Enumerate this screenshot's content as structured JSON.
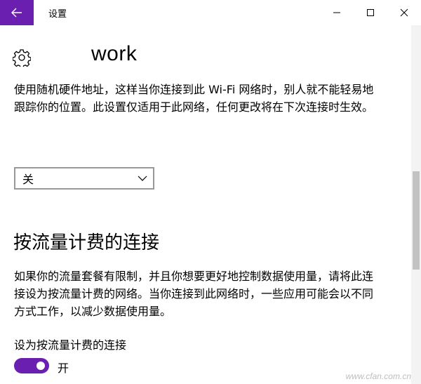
{
  "window": {
    "title": "设置",
    "back_icon": "arrow-left-icon",
    "controls": [
      "minimize-icon",
      "maximize-icon",
      "close-icon"
    ],
    "accent_color": "#6b1fb1"
  },
  "header": {
    "icon": "gear-icon",
    "network_name": "work"
  },
  "random_hw": {
    "description": "使用随机硬件地址，这样当你连接到此 Wi-Fi 网络时，别人就不能轻易地跟踪你的位置。此设置仅适用于此网络，任何更改将在下次连接时生效。",
    "dropdown_value": "关"
  },
  "metered": {
    "title": "按流量计费的连接",
    "description": "如果你的流量套餐有限制，并且你想要更好地控制数据使用量，请将此连接设为按流量计费的网络。当你连接到此网络时，一些应用可能会以不同方式工作，以减少数据使用量。",
    "toggle_label": "设为按流量计费的连接",
    "toggle_state": "开",
    "toggle_on": true
  },
  "watermark": "www.cfan.com.cn"
}
